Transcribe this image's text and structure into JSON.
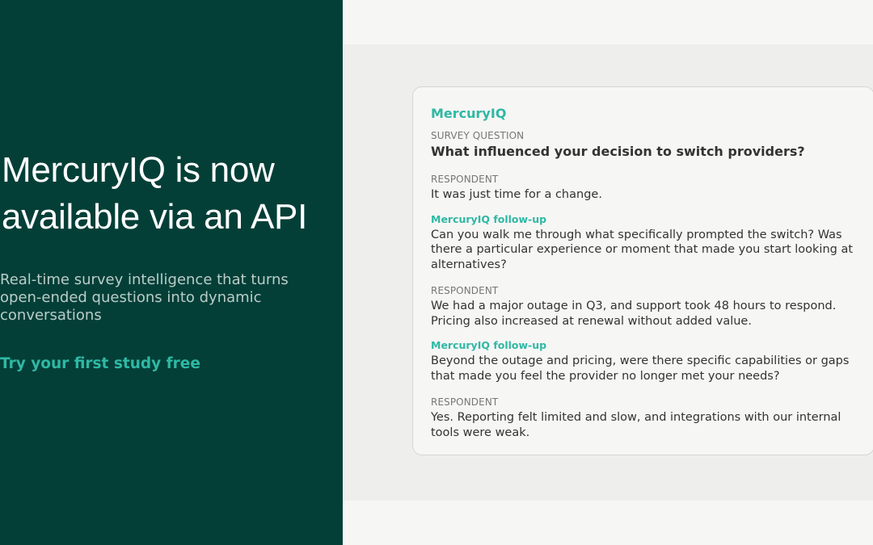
{
  "hero": {
    "headline": "MercuryIQ is now available via an API",
    "subtext": "Real-time survey intelligence that turns open-ended questions into dynamic conversations",
    "cta_label": "Try your first study free"
  },
  "card": {
    "brand": "MercuryIQ",
    "question_label": "SURVEY QUESTION",
    "question": "What influenced your decision to switch providers?",
    "exchanges": [
      {
        "type": "respondent",
        "label": "RESPONDENT",
        "text": "It was just time for a change."
      },
      {
        "type": "followup",
        "label": "MercuryIQ follow-up",
        "text": "Can you walk me through what specifically prompted the switch? Was there a particular experience or moment that made you start looking at alternatives?"
      },
      {
        "type": "respondent",
        "label": "RESPONDENT",
        "text": "We had a major outage in Q3, and support took 48 hours to respond. Pricing also increased at renewal without added value."
      },
      {
        "type": "followup",
        "label": "MercuryIQ follow-up",
        "text": "Beyond the outage and pricing, were there specific capabilities or gaps that made you feel the provider no longer met your needs?"
      },
      {
        "type": "respondent",
        "label": "RESPONDENT",
        "text": "Yes. Reporting felt limited and slow, and integrations with our internal tools were weak."
      }
    ]
  },
  "colors": {
    "panel_bg": "#043f37",
    "accent": "#2fb8a4",
    "page_bg": "#f6f6f5",
    "band_bg": "#eeeeec"
  }
}
